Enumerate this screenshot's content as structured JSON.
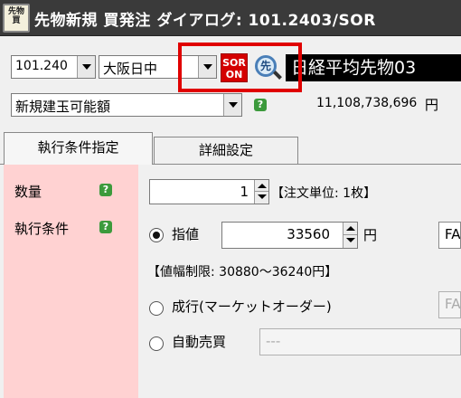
{
  "window": {
    "title": "先物新規 買発注 ダイアログ: 101.2403/SOR",
    "app_icon_text": [
      "先物",
      "買"
    ]
  },
  "symbol_bar": {
    "code_value": "101.240",
    "market_value": "大阪日中",
    "session_value": "",
    "sor_label_line1": "SOR",
    "sor_label_line2": "ON",
    "search_icon_text": "先",
    "symbol_name": "日経平均先物03"
  },
  "position_bar": {
    "type_value": "新規建玉可能額",
    "amount": "11,108,738,696",
    "amount_unit": "円"
  },
  "tabs": [
    {
      "label": "執行条件指定",
      "active": true
    },
    {
      "label": "詳細設定",
      "active": false
    }
  ],
  "order_form": {
    "quantity_label": "数量",
    "condition_label": "執行条件",
    "help_glyph": "?",
    "quantity_value": "1",
    "unit_note": "【注文単位: 1枚】",
    "limit_label": "指値",
    "limit_price": "33560",
    "price_unit": "円",
    "limit_side_value": "FA",
    "price_range": "【値幅制限: 30880～36240円】",
    "market_label": "成行(マーケットオーダー)",
    "market_side_value": "FA",
    "auto_label": "自動売買",
    "auto_value": "---",
    "selected_condition": "指値"
  },
  "colors": {
    "highlight": "#e00000",
    "sor_bg": "#d40000",
    "label_panel_bg": "#ffd2d2",
    "help_icon_bg": "#3c9a3c",
    "titlebar_bg": "#3a3a3a"
  }
}
